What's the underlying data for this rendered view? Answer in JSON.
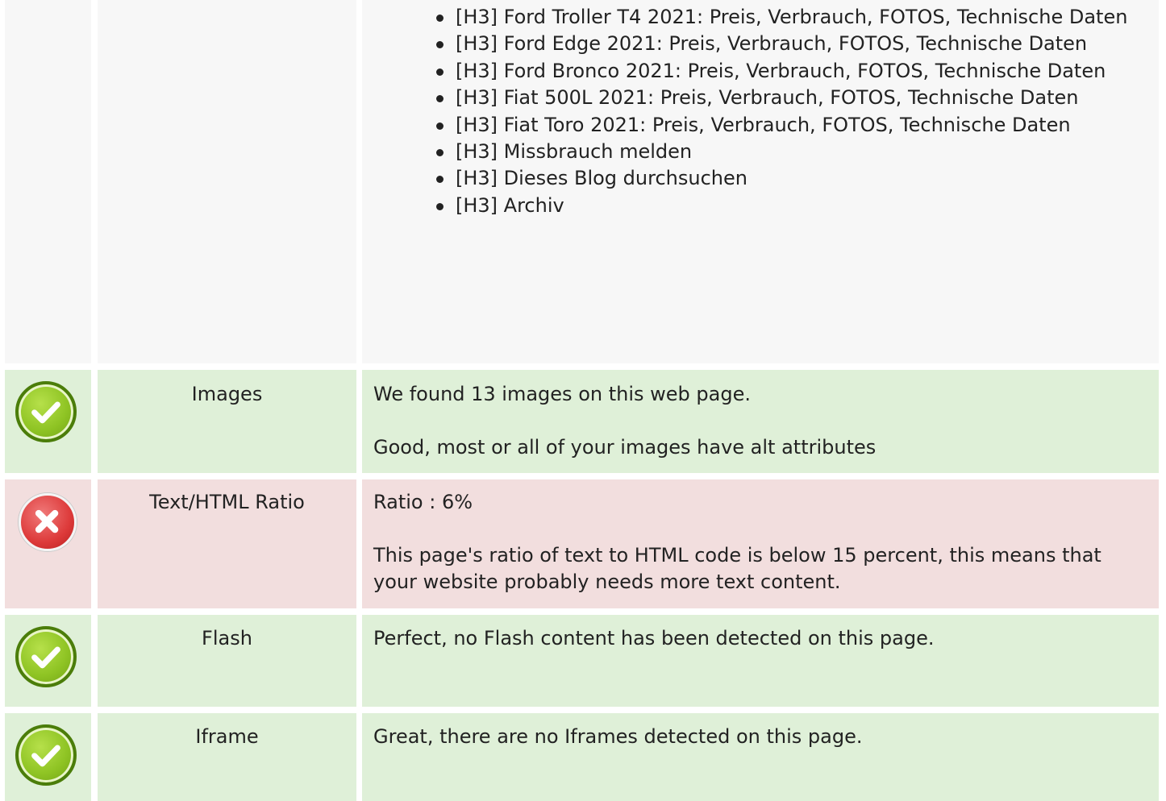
{
  "headings_list": [
    "[H3] Ford Troller T4 2021: Preis, Verbrauch, FOTOS, Technische Daten",
    "[H3] Ford Edge 2021: Preis, Verbrauch, FOTOS, Technische Daten",
    "[H3] Ford Bronco 2021: Preis, Verbrauch, FOTOS, Technische Daten",
    "[H3] Fiat 500L 2021: Preis, Verbrauch, FOTOS, Technische Daten",
    "[H3] Fiat Toro 2021: Preis, Verbrauch, FOTOS, Technische Daten",
    "[H3] Missbrauch melden",
    "[H3] Dieses Blog durchsuchen",
    "[H3] Archiv"
  ],
  "rows": {
    "images": {
      "status": "pass",
      "icon": "check-icon",
      "label": "Images",
      "line1": "We found 13 images on this web page.",
      "line2": "Good, most or all of your images have alt attributes"
    },
    "ratio": {
      "status": "fail",
      "icon": "cross-icon",
      "label": "Text/HTML Ratio",
      "line1": "Ratio : 6%",
      "line2": "This page's ratio of text to HTML code is below 15 percent, this means that your website probably needs more text content."
    },
    "flash": {
      "status": "pass",
      "icon": "check-icon",
      "label": "Flash",
      "line1": "Perfect, no Flash content has been detected on this page."
    },
    "iframe": {
      "status": "pass",
      "icon": "check-icon",
      "label": "Iframe",
      "line1": "Great, there are no Iframes detected on this page."
    }
  },
  "colors": {
    "pass_bg": "#dff0d8",
    "fail_bg": "#f2dede",
    "neutral_bg": "#f7f7f7",
    "check_green": "#8fc424",
    "cross_red": "#dd3a3a"
  }
}
